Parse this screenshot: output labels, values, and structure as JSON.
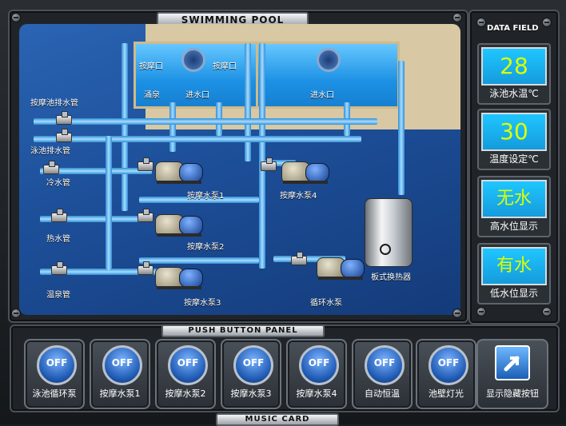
{
  "header": {
    "title": "SWIMMING POOL"
  },
  "sidebar": {
    "title": "DATA FIELD"
  },
  "cards": [
    {
      "value": "28",
      "label": "泳池水温℃"
    },
    {
      "value": "30",
      "label": "温度设定℃"
    },
    {
      "value": "无水",
      "label": "高水位显示"
    },
    {
      "value": "有水",
      "label": "低水位显示"
    }
  ],
  "diagram": {
    "labels": {
      "massage_outlet_1": "按摩口",
      "massage_outlet_2": "按摩口",
      "jet_left": "涌泉",
      "water_inlet_left": "进水口",
      "water_inlet_right": "进水口",
      "massage_drain_pipe": "按摩池排水管",
      "pool_drain_pipe": "泳池排水管",
      "cold_water_pipe": "冷水管",
      "hot_water_pipe": "热水管",
      "hot_spring_pipe": "温泉管",
      "pump_1": "按摩水泵1",
      "pump_2": "按摩水泵2",
      "pump_3": "按摩水泵3",
      "pump_4": "按摩水泵4",
      "heat_exchanger": "板式换热器",
      "circulation_pump": "循环水泵"
    }
  },
  "push_panel": {
    "title": "PUSH BUTTON PANEL",
    "buttons": [
      {
        "state": "OFF",
        "label": "泳池循环泵"
      },
      {
        "state": "OFF",
        "label": "按摩水泵1"
      },
      {
        "state": "OFF",
        "label": "按摩水泵2"
      },
      {
        "state": "OFF",
        "label": "按摩水泵3"
      },
      {
        "state": "OFF",
        "label": "按摩水泵4"
      },
      {
        "state": "OFF",
        "label": "自动恒温"
      },
      {
        "state": "OFF",
        "label": "池壁灯光"
      }
    ],
    "reveal_label": "显示隐藏按钮"
  },
  "footer": {
    "title": "MUSIC CARD"
  }
}
